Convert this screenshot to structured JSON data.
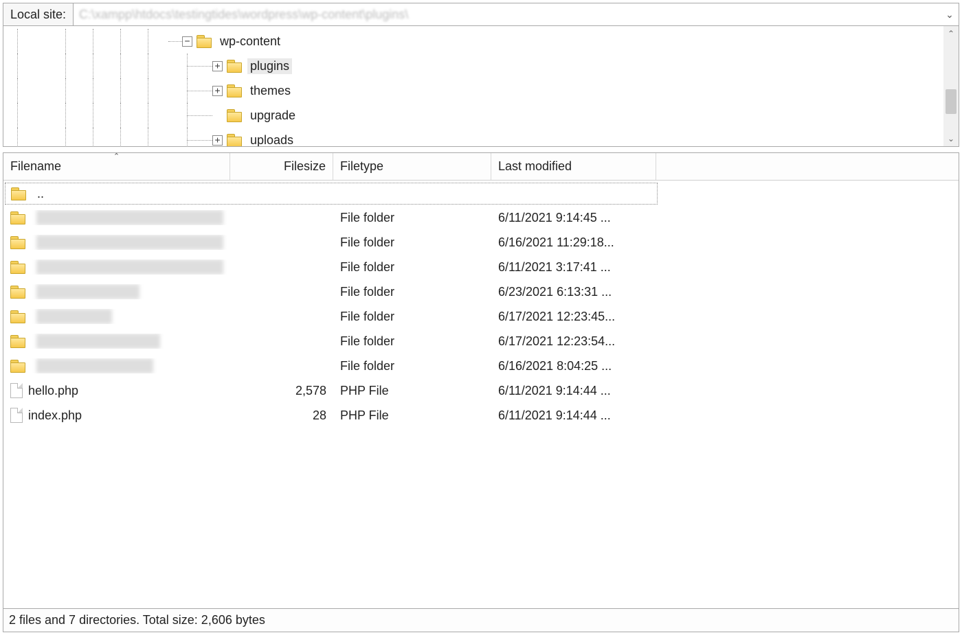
{
  "pathbar": {
    "label": "Local site:",
    "value": "C:\\xampp\\htdocs\\testingtides\\wordpress\\wp-content\\plugins\\"
  },
  "tree": {
    "items": [
      {
        "label": "wp-content",
        "expander": "−",
        "selected": false,
        "depth": 0
      },
      {
        "label": "plugins",
        "expander": "+",
        "selected": true,
        "depth": 1
      },
      {
        "label": "themes",
        "expander": "+",
        "selected": false,
        "depth": 1
      },
      {
        "label": "upgrade",
        "expander": "",
        "selected": false,
        "depth": 1
      },
      {
        "label": "uploads",
        "expander": "+",
        "selected": false,
        "depth": 1
      }
    ]
  },
  "filelist": {
    "headers": {
      "filename": "Filename",
      "filesize": "Filesize",
      "filetype": "Filetype",
      "modified": "Last modified"
    },
    "parent_label": "..",
    "rows": [
      {
        "icon": "folder",
        "name": "a",
        "blur_w": 340,
        "size": "",
        "type": "File folder",
        "modified": "6/11/2021 9:14:45 ..."
      },
      {
        "icon": "folder",
        "name": "b",
        "blur_w": 280,
        "size": "",
        "type": "File folder",
        "modified": "6/16/2021 11:29:18..."
      },
      {
        "icon": "folder",
        "name": "b",
        "blur_w": 340,
        "size": "",
        "type": "File folder",
        "modified": "6/11/2021 3:17:41 ..."
      },
      {
        "icon": "folder",
        "name": "c",
        "blur_w": 150,
        "size": "",
        "type": "File folder",
        "modified": "6/23/2021 6:13:31 ..."
      },
      {
        "icon": "folder",
        "name": "f",
        "blur_w": 110,
        "size": "",
        "type": "File folder",
        "modified": "6/17/2021 12:23:45..."
      },
      {
        "icon": "folder",
        "name": "f",
        "blur_w": 180,
        "size": "",
        "type": "File folder",
        "modified": "6/17/2021 12:23:54..."
      },
      {
        "icon": "folder",
        "name": "v",
        "blur_w": 170,
        "size": "",
        "type": "File folder",
        "modified": "6/16/2021 8:04:25 ..."
      },
      {
        "icon": "file",
        "name": "hello.php",
        "blur_w": 0,
        "size": "2,578",
        "type": "PHP File",
        "modified": "6/11/2021 9:14:44 ..."
      },
      {
        "icon": "file",
        "name": "index.php",
        "blur_w": 0,
        "size": "28",
        "type": "PHP File",
        "modified": "6/11/2021 9:14:44 ..."
      }
    ]
  },
  "status": "2 files and 7 directories. Total size: 2,606 bytes"
}
